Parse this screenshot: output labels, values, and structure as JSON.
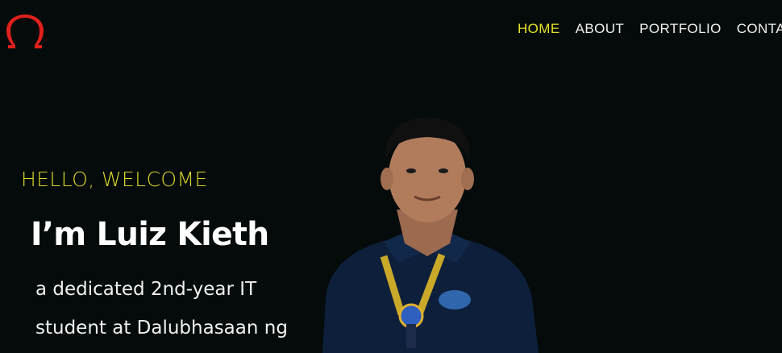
{
  "brand": {
    "logo_icon": "omega-logo-icon",
    "logo_color": "#e0201c"
  },
  "nav": {
    "items": [
      {
        "label": "HOME",
        "active": true
      },
      {
        "label": "ABOUT",
        "active": false
      },
      {
        "label": "PORTFOLIO",
        "active": false
      },
      {
        "label": "CONTACT",
        "active": false
      }
    ],
    "active_color": "#e7e22a"
  },
  "hero": {
    "greeting": "HELLO, WELCOME",
    "headline": "I’m Luiz Kieth",
    "intro": "a dedicated 2nd-year IT student at Dalubhasaan ng"
  },
  "colors": {
    "background": "#050b0b",
    "accent": "#d8d52a",
    "text": "#ffffff"
  }
}
